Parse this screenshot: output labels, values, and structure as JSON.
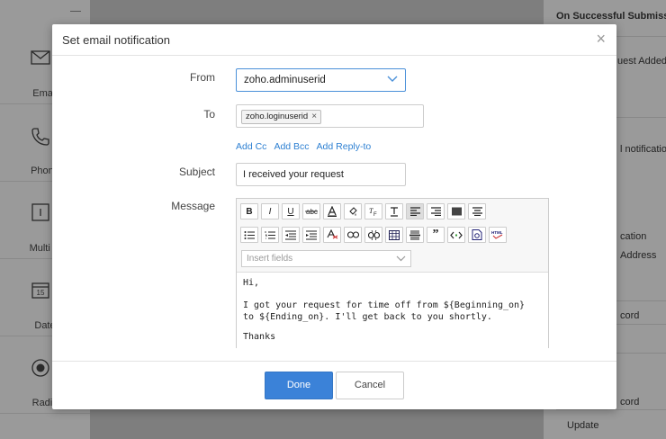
{
  "background": {
    "left_fields": [
      {
        "label": "Email",
        "icon": "envelope-icon"
      },
      {
        "label": "Phone",
        "icon": "phone-icon"
      },
      {
        "label": "Multi Li",
        "icon": "multiline-icon"
      },
      {
        "label": "Date",
        "icon": "calendar-icon"
      },
      {
        "label": "Radio",
        "icon": "radio-icon"
      }
    ],
    "calendar_day": "15",
    "right_texts": {
      "on_success": "On Successful Submission",
      "request_added": "uest Added",
      "notification": "l notification",
      "cation": "cation",
      "address": "Address",
      "ecord1": "cord",
      "ecord2": "cord",
      "update": "Update"
    }
  },
  "modal": {
    "title": "Set email notification",
    "from": {
      "label": "From",
      "value": "zoho.adminuserid"
    },
    "to": {
      "label": "To",
      "chips": [
        "zoho.loginuserid"
      ]
    },
    "links": {
      "cc": "Add Cc",
      "bcc": "Add Bcc",
      "reply_to": "Add Reply-to"
    },
    "subject": {
      "label": "Subject",
      "value": "I received your request"
    },
    "message": {
      "label": "Message",
      "insert_fields_placeholder": "Insert fields",
      "lines": [
        "Hi,",
        "",
        "I got your request for time off from ${Beginning_on}",
        "to ${Ending_on}. I'll get back to you shortly.",
        "",
        "Thanks"
      ]
    },
    "buttons": {
      "done": "Done",
      "cancel": "Cancel"
    }
  }
}
